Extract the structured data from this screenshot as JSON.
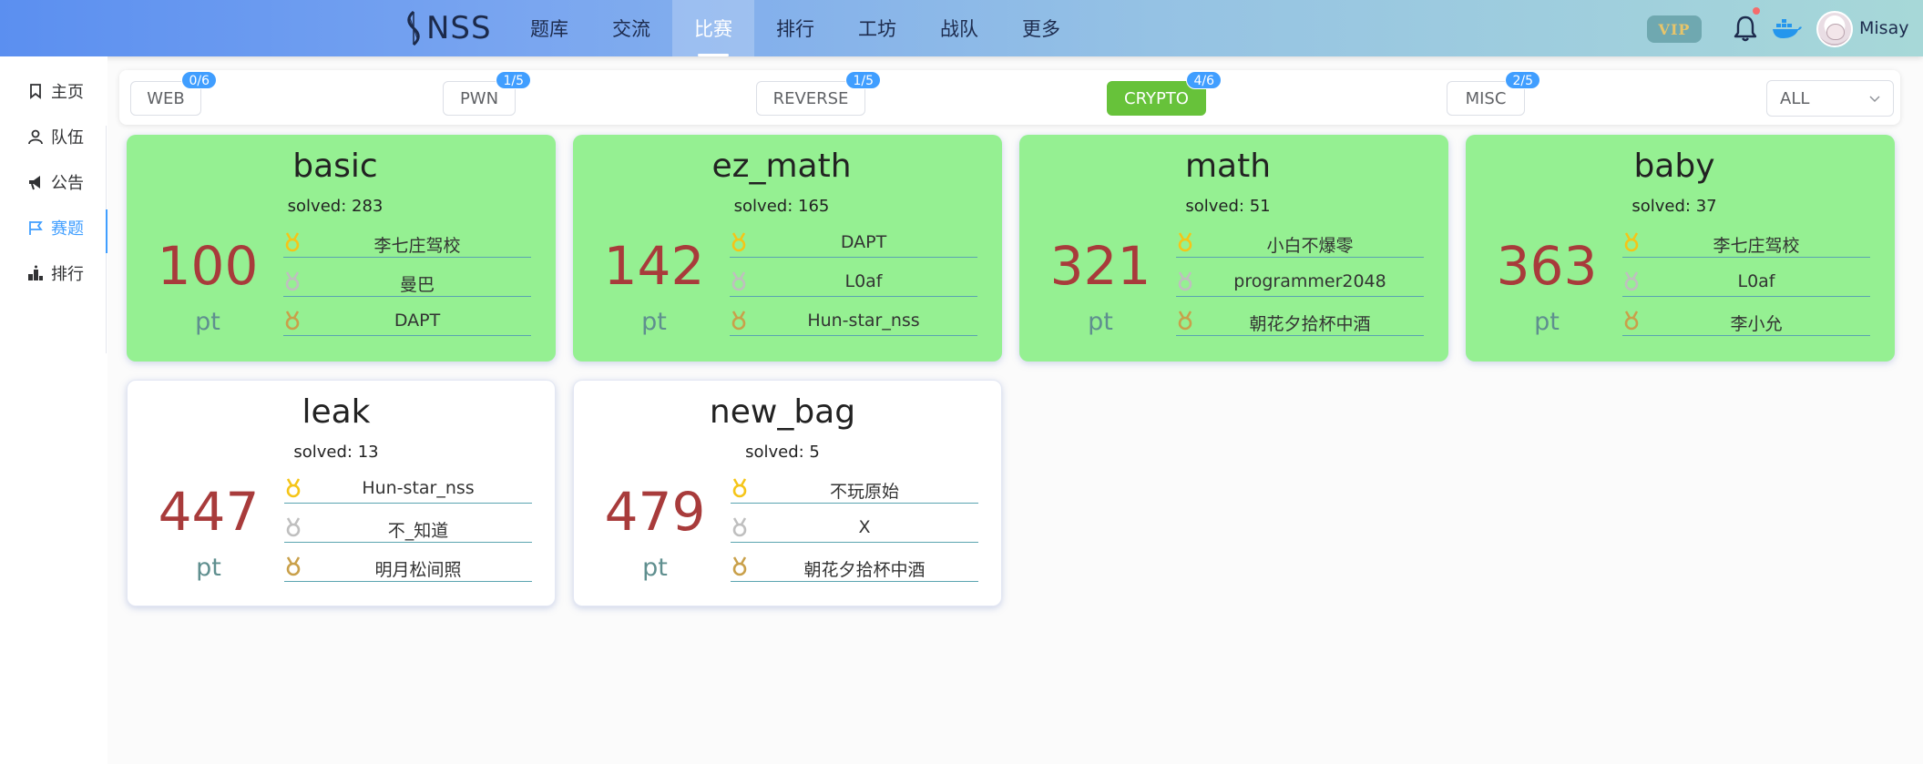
{
  "brand": {
    "logo_text": "NSS"
  },
  "nav": [
    {
      "label": "题库",
      "active": false
    },
    {
      "label": "交流",
      "active": false
    },
    {
      "label": "比赛",
      "active": true
    },
    {
      "label": "排行",
      "active": false
    },
    {
      "label": "工坊",
      "active": false
    },
    {
      "label": "战队",
      "active": false
    },
    {
      "label": "更多",
      "active": false
    }
  ],
  "header_right": {
    "vip_label": "VIP",
    "user_name": "Misay",
    "icons": [
      "bell-icon",
      "docker-icon"
    ]
  },
  "sidebar": [
    {
      "label": "主页",
      "icon": "bookmark-icon",
      "active": false
    },
    {
      "label": "队伍",
      "icon": "user-icon",
      "active": false
    },
    {
      "label": "公告",
      "icon": "megaphone-icon",
      "active": false
    },
    {
      "label": "赛题",
      "icon": "flag-icon",
      "active": true
    },
    {
      "label": "排行",
      "icon": "podium-icon",
      "active": false
    }
  ],
  "categories": [
    {
      "label": "WEB",
      "badge": "0/6",
      "active": false
    },
    {
      "label": "PWN",
      "badge": "1/5",
      "active": false
    },
    {
      "label": "REVERSE",
      "badge": "1/5",
      "active": false
    },
    {
      "label": "CRYPTO",
      "badge": "4/6",
      "active": true
    },
    {
      "label": "MISC",
      "badge": "2/5",
      "active": false
    }
  ],
  "filter": {
    "selected": "ALL"
  },
  "colors": {
    "solved_card": "#95f092",
    "accent": "#409eff",
    "active_tab": "#67c23a",
    "score": "#a83b3b",
    "gold": "#f5c518",
    "silver": "#bfbfbf",
    "bronze": "#c9a04a"
  },
  "challenges": [
    {
      "name": "basic",
      "solved_text": "solved: 283",
      "score": "100",
      "unit": "pt",
      "solved_by_me": true,
      "top3": [
        "李七庄驾校",
        "曼巴",
        "DAPT"
      ]
    },
    {
      "name": "ez_math",
      "solved_text": "solved: 165",
      "score": "142",
      "unit": "pt",
      "solved_by_me": true,
      "top3": [
        "DAPT",
        "L0af",
        "Hun-star_nss"
      ]
    },
    {
      "name": "math",
      "solved_text": "solved: 51",
      "score": "321",
      "unit": "pt",
      "solved_by_me": true,
      "top3": [
        "小白不爆零",
        "programmer2048",
        "朝花夕拾杯中酒"
      ]
    },
    {
      "name": "baby",
      "solved_text": "solved: 37",
      "score": "363",
      "unit": "pt",
      "solved_by_me": true,
      "top3": [
        "李七庄驾校",
        "L0af",
        "李小允"
      ]
    },
    {
      "name": "leak",
      "solved_text": "solved: 13",
      "score": "447",
      "unit": "pt",
      "solved_by_me": false,
      "top3": [
        "Hun-star_nss",
        "不_知道",
        "明月松间照"
      ]
    },
    {
      "name": "new_bag",
      "solved_text": "solved: 5",
      "score": "479",
      "unit": "pt",
      "solved_by_me": false,
      "top3": [
        "不玩原始",
        "X",
        "朝花夕拾杯中酒"
      ]
    }
  ]
}
